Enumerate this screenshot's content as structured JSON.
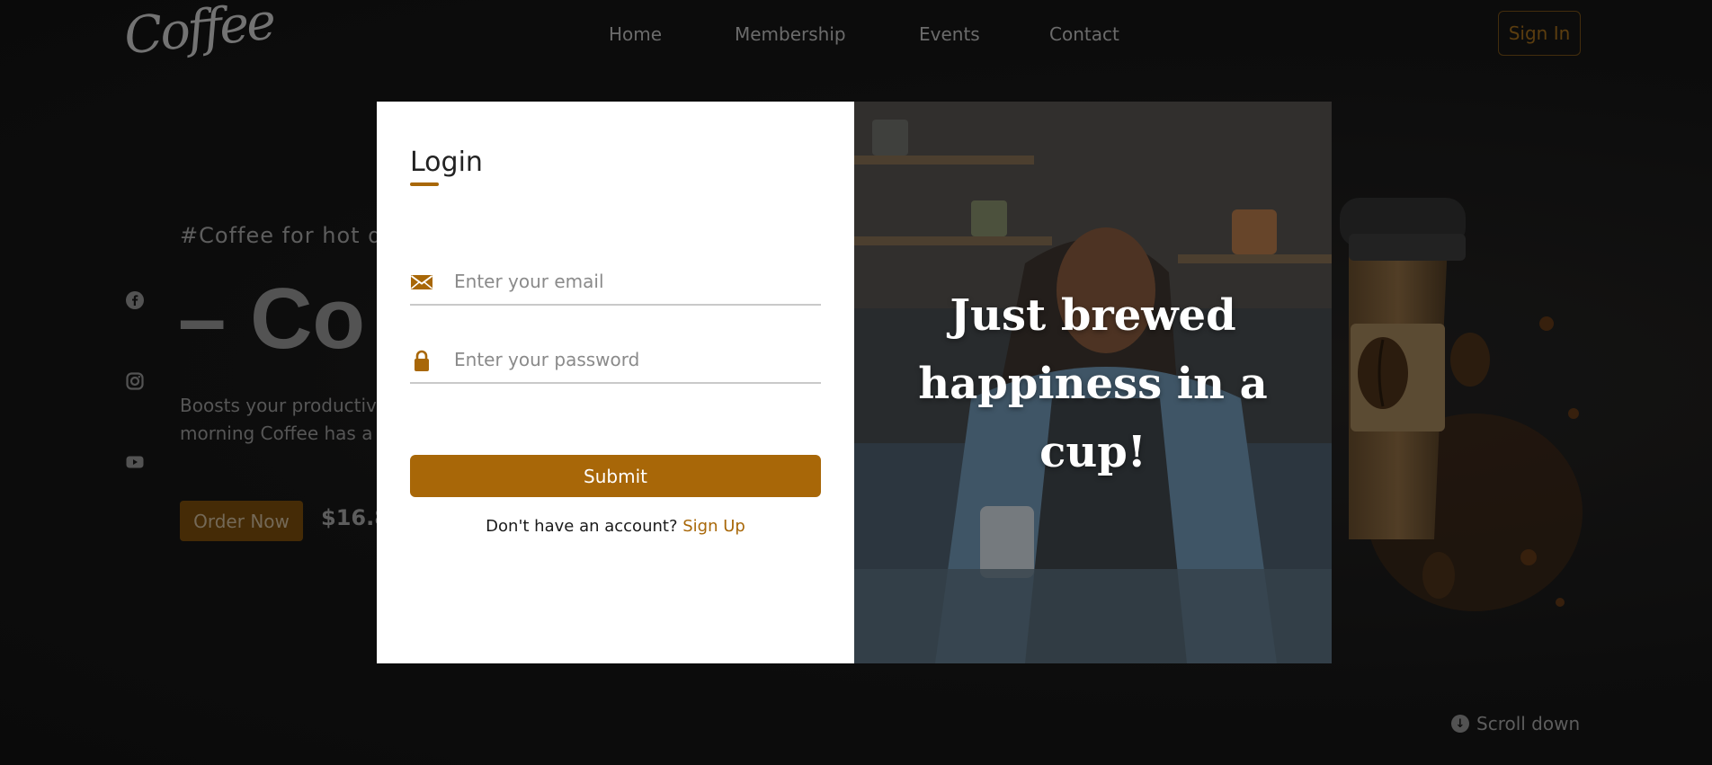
{
  "header": {
    "logo": "Coffee",
    "nav": [
      {
        "label": "Home"
      },
      {
        "label": "Membership"
      },
      {
        "label": "Events"
      },
      {
        "label": "Contact"
      }
    ],
    "sign_in_label": "Sign In"
  },
  "hero": {
    "tag": "#Coffee for hot do",
    "title": "– Co",
    "description_line1": "Boosts your productivi",
    "description_line2": "morning Coffee has a",
    "order_label": "Order Now",
    "price": "$16.8",
    "social_icons": [
      "facebook-icon",
      "instagram-icon",
      "youtube-icon"
    ]
  },
  "scroll_down_label": "Scroll down",
  "login_modal": {
    "title": "Login",
    "email_placeholder": "Enter your email",
    "email_icon": "envelope-icon",
    "password_placeholder": "Enter your password",
    "password_icon": "lock-icon",
    "submit_label": "Submit",
    "signup_prompt": "Don't have an account?",
    "signup_link": "Sign Up",
    "image_caption": "Just brewed happiness in a cup!"
  },
  "colors": {
    "accent": "#a86708",
    "background": "#121212",
    "modal_bg": "#ffffff"
  }
}
